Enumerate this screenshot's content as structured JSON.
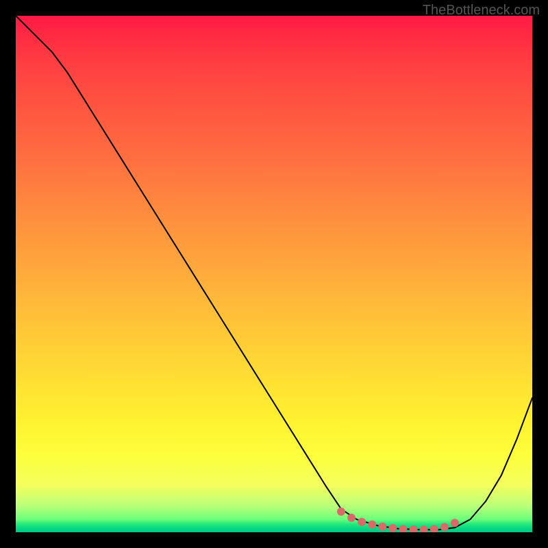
{
  "watermark": "TheBottleneck.com",
  "chart_data": {
    "type": "line",
    "title": "",
    "xlabel": "",
    "ylabel": "",
    "xlim": [
      0,
      100
    ],
    "ylim": [
      0,
      100
    ],
    "series": [
      {
        "name": "curve",
        "x": [
          0,
          7,
          10,
          15,
          20,
          25,
          30,
          35,
          40,
          45,
          50,
          55,
          60,
          63,
          66,
          70,
          74,
          78,
          82,
          85,
          88,
          91,
          94,
          97,
          100
        ],
        "y": [
          100,
          93,
          89,
          81,
          73,
          65,
          57,
          49,
          41,
          33,
          25,
          17,
          9,
          4.5,
          2.5,
          1.3,
          0.7,
          0.5,
          0.5,
          0.9,
          2.5,
          6,
          11,
          18,
          26
        ]
      }
    ],
    "markers": {
      "name": "bottom-dots",
      "color": "#d96a6a",
      "x": [
        63,
        65,
        67,
        69,
        71,
        73,
        75,
        77,
        79,
        81,
        83,
        85
      ],
      "y": [
        4.0,
        2.8,
        2.0,
        1.5,
        1.1,
        0.8,
        0.6,
        0.5,
        0.5,
        0.6,
        1.0,
        1.8
      ]
    }
  }
}
